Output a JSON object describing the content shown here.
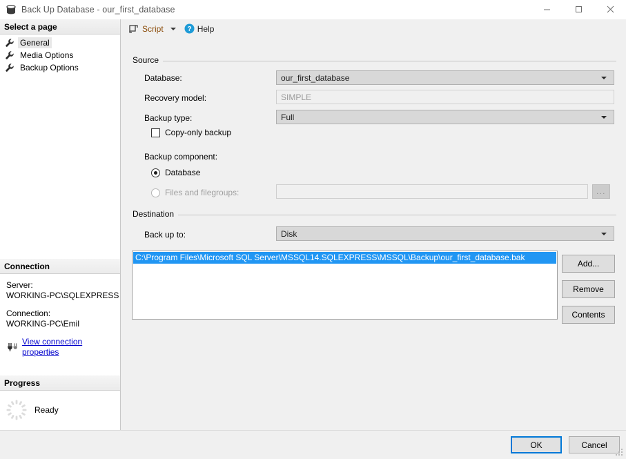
{
  "window": {
    "title": "Back Up Database - our_first_database",
    "icon": "database-icon",
    "minimize": "—",
    "maximize": "□",
    "close": "✕"
  },
  "sidebar": {
    "select_page_header": "Select a page",
    "pages": [
      {
        "label": "General",
        "selected": true
      },
      {
        "label": "Media Options",
        "selected": false
      },
      {
        "label": "Backup Options",
        "selected": false
      }
    ],
    "connection": {
      "header": "Connection",
      "server_label": "Server:",
      "server_value": "WORKING-PC\\SQLEXPRESS",
      "connection_label": "Connection:",
      "connection_value": "WORKING-PC\\Emil",
      "view_properties_link": "View connection properties"
    },
    "progress": {
      "header": "Progress",
      "status": "Ready"
    }
  },
  "toolbar": {
    "script_label": "Script",
    "help_label": "Help"
  },
  "source": {
    "group_title": "Source",
    "database_label": "Database:",
    "database_value": "our_first_database",
    "recovery_model_label": "Recovery model:",
    "recovery_model_value": "SIMPLE",
    "backup_type_label": "Backup type:",
    "backup_type_value": "Full",
    "copy_only_label": "Copy-only backup",
    "copy_only_checked": false,
    "backup_component_label": "Backup component:",
    "component_database_label": "Database",
    "component_database_selected": true,
    "component_files_label": "Files and filegroups:",
    "component_files_selected": false,
    "component_files_value": "",
    "browse_button_label": "..."
  },
  "destination": {
    "group_title": "Destination",
    "back_up_to_label": "Back up to:",
    "back_up_to_value": "Disk",
    "targets": [
      "C:\\Program Files\\Microsoft SQL Server\\MSSQL14.SQLEXPRESS\\MSSQL\\Backup\\our_first_database.bak"
    ],
    "add_label": "Add...",
    "remove_label": "Remove",
    "contents_label": "Contents"
  },
  "footer": {
    "ok_label": "OK",
    "cancel_label": "Cancel"
  },
  "colors": {
    "accent": "#0078d7",
    "selection": "#2196f3",
    "link": "#0000cc",
    "script_text": "#8a4b08",
    "help_blue": "#1e9bd7"
  }
}
